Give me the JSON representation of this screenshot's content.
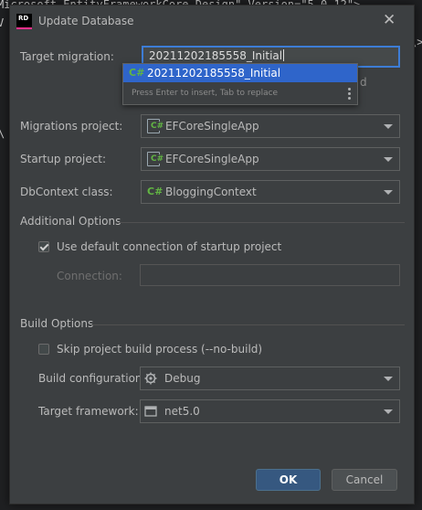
{
  "background": {
    "line1": "Microsoft.EntityFrameworkCore.Design\" Version=\"5.0.12\">",
    "line2_left": "V",
    "line2_right": "\\>",
    "line3": "\\"
  },
  "dialog": {
    "app_logo": "RD",
    "title": "Update Database",
    "close_glyph": "✕"
  },
  "target_migration": {
    "label": "Target migration:",
    "value": "20211202185558_Initial",
    "obscured_tail": "d"
  },
  "autocomplete": {
    "icon": "C#",
    "item": "20211202185558_Initial",
    "hint": "Press Enter to insert, Tab to replace"
  },
  "migrations_project": {
    "label": "Migrations project:",
    "value": "EFCoreSingleApp"
  },
  "startup_project": {
    "label": "Startup project:",
    "value": "EFCoreSingleApp"
  },
  "dbcontext": {
    "label": "DbContext class:",
    "icon": "C#",
    "value": "BloggingContext"
  },
  "additional_options": {
    "title": "Additional Options",
    "use_default_label": "Use default connection of startup project",
    "use_default_checked": true,
    "connection_label": "Connection:",
    "connection_value": ""
  },
  "build_options": {
    "title": "Build Options",
    "skip_build_label": "Skip project build process (--no-build)",
    "skip_build_checked": false,
    "configuration_label": "Build configuration:",
    "configuration_value": "Debug",
    "framework_label": "Target framework:",
    "framework_value": "net5.0"
  },
  "buttons": {
    "ok": "OK",
    "cancel": "Cancel"
  },
  "colors": {
    "accent": "#2f65ca",
    "ok_button": "#365880",
    "focus_border": "#3d7dd6",
    "dialog_bg": "#3c3f41"
  }
}
